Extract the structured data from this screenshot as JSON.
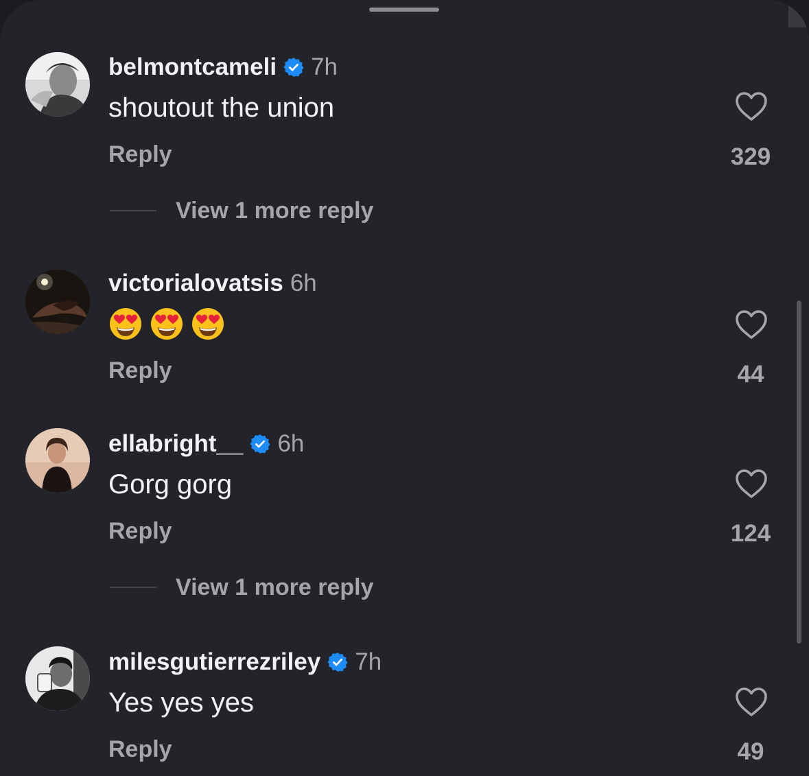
{
  "colors": {
    "background": "#232429",
    "text_primary": "#f2f2f4",
    "text_secondary": "#a4a6ac",
    "verified_blue": "#1d8cf8"
  },
  "comments": [
    {
      "username": "belmontcameli",
      "verified": true,
      "time": "7h",
      "text": "shoutout the union",
      "reply_label": "Reply",
      "likes": "329",
      "view_more": "View 1 more reply"
    },
    {
      "username": "victorialovatsis",
      "verified": false,
      "time": "6h",
      "emojis": [
        "heart-eyes-emoji",
        "heart-eyes-emoji",
        "heart-eyes-emoji"
      ],
      "reply_label": "Reply",
      "likes": "44"
    },
    {
      "username": "ellabright__",
      "verified": true,
      "time": "6h",
      "text": "Gorg gorg",
      "reply_label": "Reply",
      "likes": "124",
      "view_more": "View 1 more reply"
    },
    {
      "username": "milesgutierrezriley",
      "verified": true,
      "time": "7h",
      "text": "Yes yes yes",
      "reply_label": "Reply",
      "likes": "49"
    }
  ]
}
